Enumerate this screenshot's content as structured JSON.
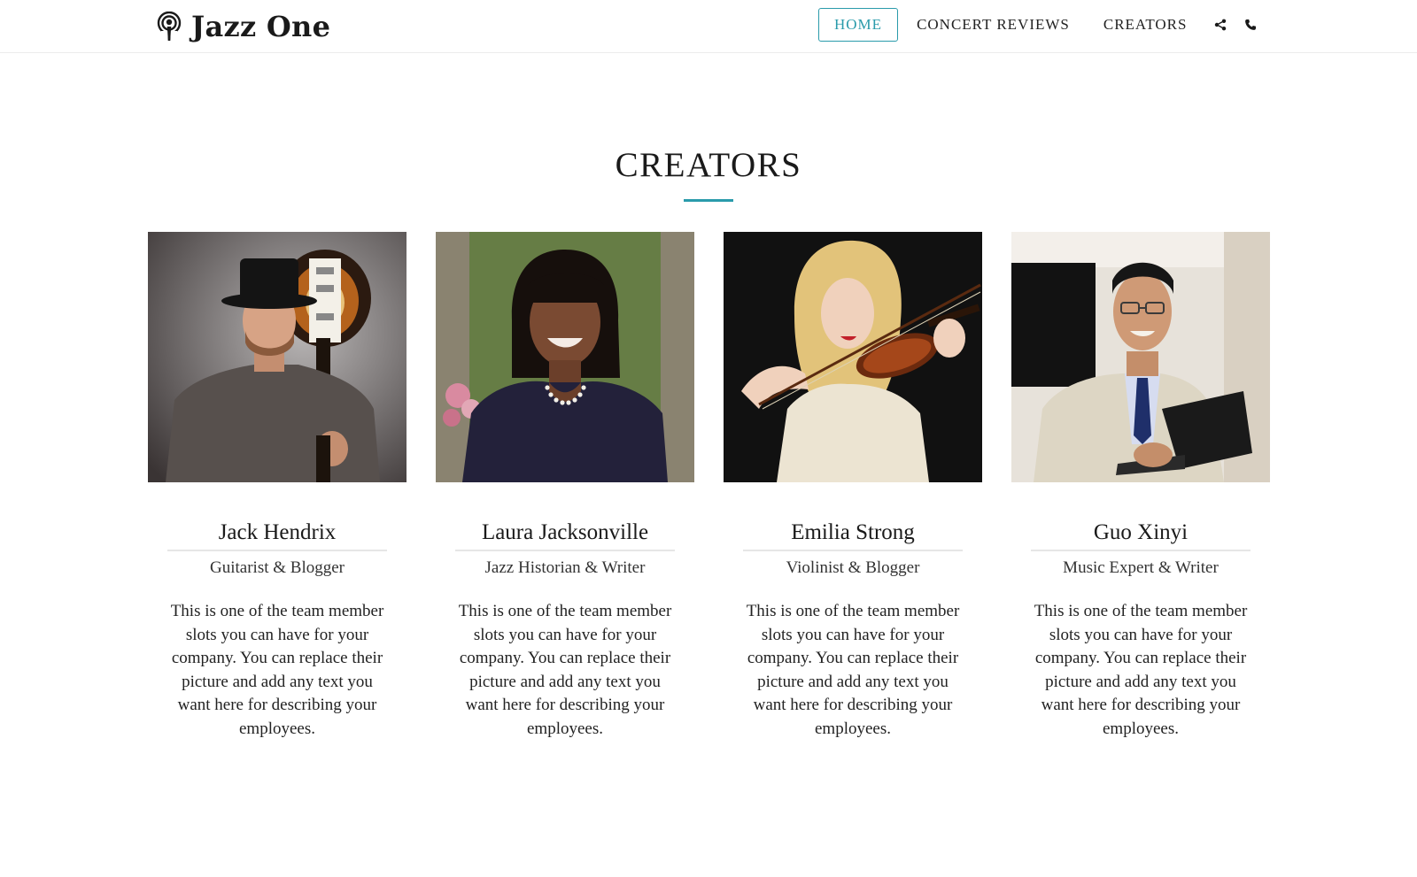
{
  "brand": {
    "name": "Jazz One",
    "icon": "podcast-icon"
  },
  "nav": {
    "items": [
      {
        "label": "HOME",
        "active": true
      },
      {
        "label": "CONCERT REVIEWS",
        "active": false
      },
      {
        "label": "CREATORS",
        "active": false
      }
    ],
    "icons": [
      "share-icon",
      "phone-icon"
    ]
  },
  "colors": {
    "accent": "#2a9bab",
    "text": "#1a1a1a",
    "divider": "#e6e6e6"
  },
  "section": {
    "title": "CREATORS"
  },
  "creators": [
    {
      "name": "Jack Hendrix",
      "role": "Guitarist & Blogger",
      "bio": "This is one of the team member slots you can have for your company. You can replace their picture and add any text you want here for describing your employees."
    },
    {
      "name": "Laura Jacksonville",
      "role": "Jazz Historian & Writer",
      "bio": "This is one of the team member slots you can have for your company. You can replace their picture and add any text you want here for describing your employees."
    },
    {
      "name": "Emilia Strong",
      "role": "Violinist & Blogger",
      "bio": "This is one of the team member slots you can have for your company. You can replace their picture and add any text you want here for describing your employees."
    },
    {
      "name": "Guo Xinyi",
      "role": "Music Expert & Writer",
      "bio": "This is one of the team member slots you can have for your company. You can replace their picture and add any text you want here for describing your employees."
    }
  ]
}
